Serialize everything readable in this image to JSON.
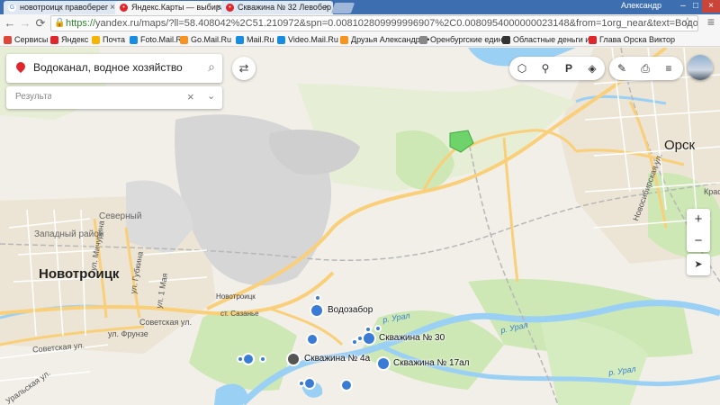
{
  "browser": {
    "tabs": [
      {
        "title": "новотроицк правоберег",
        "favicon": "google-icon"
      },
      {
        "title": "Яндекс.Карты — выбира",
        "favicon": "yandex-maps-icon"
      },
      {
        "title": "Скважина № 32 Левобер",
        "favicon": "yandex-maps-icon"
      }
    ],
    "user_name": "Александр",
    "url_https": "https://",
    "url_rest": "yandex.ru/maps/?ll=58.408042%2C51.210972&spn=0.008102809999996907%2C0.0080954000000023148&from=1org_near&text=Водоканал%",
    "bookmarks": [
      {
        "label": "Сервисы",
        "icon": "apps-icon",
        "color": "#e0453a"
      },
      {
        "label": "Яндекс",
        "icon": "yandex-icon",
        "color": "#e0262b"
      },
      {
        "label": "Почта",
        "icon": "mail-icon",
        "color": "#f5b400"
      },
      {
        "label": "Foto.Mail.Ru",
        "icon": "foto-icon",
        "color": "#168de2"
      },
      {
        "label": "Go.Mail.Ru",
        "icon": "go-icon",
        "color": "#f7931e"
      },
      {
        "label": "Mail.Ru",
        "icon": "mailru-icon",
        "color": "#168de2"
      },
      {
        "label": "Video.Mail.Ru",
        "icon": "video-icon",
        "color": "#168de2"
      },
      {
        "label": "Друзья Александра •",
        "icon": "ok-icon",
        "color": "#f7931e"
      },
      {
        "label": "Оренбургские един",
        "icon": "orenburg-icon",
        "color": "#888888"
      },
      {
        "label": "Областные деньги и",
        "icon": "region-icon",
        "color": "#333333"
      },
      {
        "label": "Глава Орска Виктор",
        "icon": "youtube-icon",
        "color": "#e0262b"
      }
    ]
  },
  "search": {
    "query": "Водоканал, водное хозяйство",
    "results_label": "Результат"
  },
  "map": {
    "points": [
      {
        "label": "Водозабор"
      },
      {
        "label": "Скважина № 30"
      },
      {
        "label": "Скважина № 4а"
      },
      {
        "label": "Скважина № 17ал"
      }
    ],
    "places": {
      "novotroitsk": "Новотроицк",
      "orsk": "Орск",
      "severny": "Северный",
      "zapadny": "Западный район",
      "novotroitsk_small": "Новотроицк",
      "sazanye": "ст. Сазанье",
      "ural1": "р. Урал",
      "ural2": "р. Урал",
      "ural3": "р. Урал"
    },
    "streets": {
      "sovetskaya1": "Советская ул.",
      "sovetskaya2": "Советская ул.",
      "frunze": "ул. Фрунзе",
      "uralskaya": "Уральская ул.",
      "michurina": "ул. Мичурина",
      "gubkina": "ул. Губкина",
      "may1": "ул. 1 Мая",
      "novosib": "Новосибирская ул.",
      "krasn": "Красн"
    },
    "colors": {
      "road": "#f9cf7a",
      "water": "#9bd0f5",
      "green": "#cde8b5",
      "industrial": "#d6d6d6",
      "point": "#3a7bd5"
    }
  }
}
